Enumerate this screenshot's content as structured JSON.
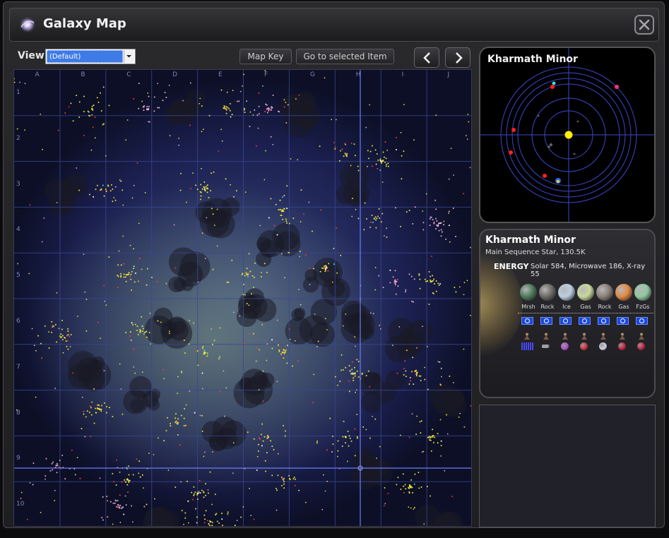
{
  "window": {
    "title": "Galaxy Map"
  },
  "toolbar": {
    "view_label": "View",
    "view_value": "(Default)",
    "map_key_label": "Map Key",
    "goto_label": "Go to selected Item"
  },
  "map": {
    "columns": [
      "A",
      "B",
      "C",
      "D",
      "E",
      "F",
      "G",
      "H",
      "I",
      "J"
    ],
    "rows": [
      "1",
      "2",
      "3",
      "4",
      "5",
      "6",
      "7",
      "8",
      "9",
      "10"
    ]
  },
  "orbit": {
    "title": "Kharmath Minor"
  },
  "info": {
    "name": "Kharmath Minor",
    "subtitle": "Main Sequence Star, 130.5K",
    "energy_label": "ENERGY",
    "energy_values": "Solar 584, Microwave 186, X-ray 55",
    "planets": [
      {
        "label": "Mrsh",
        "color": "#4d7a5a"
      },
      {
        "label": "Rock",
        "color": "#6e6a66"
      },
      {
        "label": "Ice",
        "color": "#b9cfe0"
      },
      {
        "label": "Gas",
        "color": "#c7d79a"
      },
      {
        "label": "Rock",
        "color": "#8a8078"
      },
      {
        "label": "Gas",
        "color": "#e08a45"
      },
      {
        "label": "FzGs",
        "color": "#8fc8a0"
      }
    ]
  },
  "colors": {
    "accent": "#3f7be6",
    "star_yellow": "#e8e23a",
    "star_pink": "#e7a9d6"
  }
}
